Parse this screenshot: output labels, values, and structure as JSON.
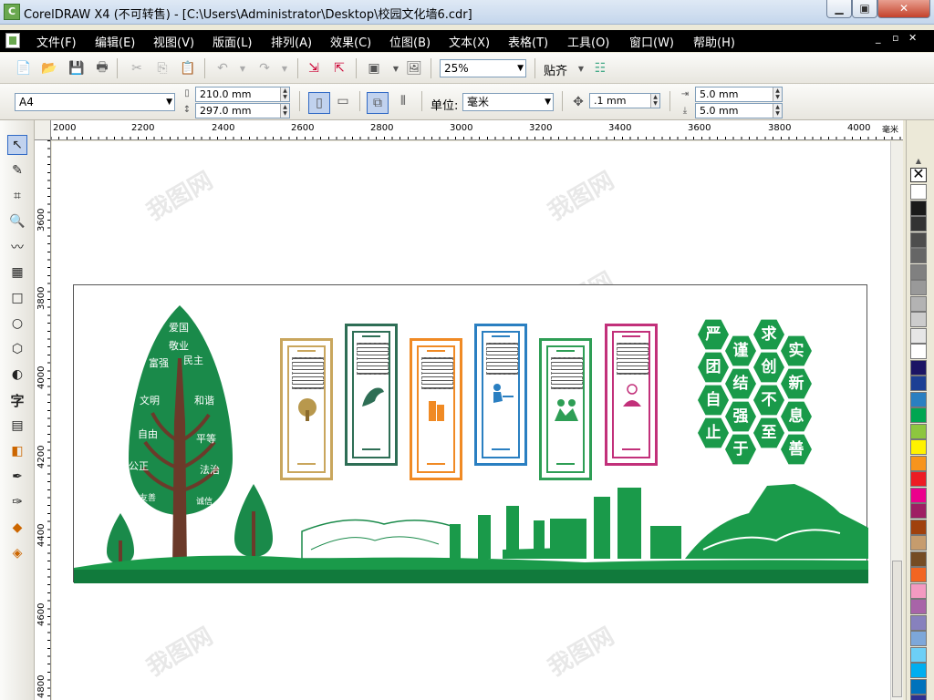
{
  "window": {
    "title": "CorelDRAW X4 (不可转售) - [C:\\Users\\Administrator\\Desktop\\校园文化墙6.cdr]"
  },
  "menu": {
    "items": [
      "文件(F)",
      "编辑(E)",
      "视图(V)",
      "版面(L)",
      "排列(A)",
      "效果(C)",
      "位图(B)",
      "文本(X)",
      "表格(T)",
      "工具(O)",
      "窗口(W)",
      "帮助(H)"
    ]
  },
  "toolbar": {
    "zoom": "25%",
    "snap_label": "贴齐"
  },
  "property_bar": {
    "page_size": "A4",
    "width": "210.0 mm",
    "height": "297.0 mm",
    "unit_label": "单位:",
    "unit_value": "毫米",
    "nudge": ".1 mm",
    "dup_x": "5.0 mm",
    "dup_y": "5.0 mm"
  },
  "ruler": {
    "h_labels": [
      "2000",
      "2200",
      "2400",
      "2600",
      "2800",
      "3000",
      "3200",
      "3400",
      "3600",
      "3800",
      "4000"
    ],
    "h_unit": "毫米",
    "v_labels": [
      "3600",
      "3800",
      "4000",
      "4200",
      "4400",
      "4600",
      "4800"
    ]
  },
  "design": {
    "tree_words": [
      "爱国",
      "敬业",
      "富强",
      "民主",
      "文明",
      "和谐",
      "自由",
      "平等",
      "公正",
      "法治",
      "友善",
      "诚信"
    ],
    "hex_chars": [
      "严",
      "求",
      "谨",
      "实",
      "团",
      "创",
      "结",
      "新",
      "自",
      "不",
      "强",
      "息",
      "止",
      "至",
      "于",
      "善"
    ],
    "watermark": "我图网"
  },
  "palette": {
    "colors": [
      "#ffffff",
      "#1a1a1a",
      "#333333",
      "#4d4d4d",
      "#666666",
      "#808080",
      "#999999",
      "#b3b3b3",
      "#cccccc",
      "#e6e6e6",
      "#ffffff",
      "#1b1464",
      "#1c3f94",
      "#2a7fc1",
      "#00a651",
      "#8dc63f",
      "#fff200",
      "#f7941d",
      "#ed1c24",
      "#ec008c",
      "#9e1f63",
      "#a0410d",
      "#c69c6d",
      "#754c24",
      "#f26522",
      "#f49ac1",
      "#a864a8",
      "#8781bd",
      "#7da7d9",
      "#6dcff6",
      "#00aeef",
      "#0072bc",
      "#2e3192"
    ]
  }
}
